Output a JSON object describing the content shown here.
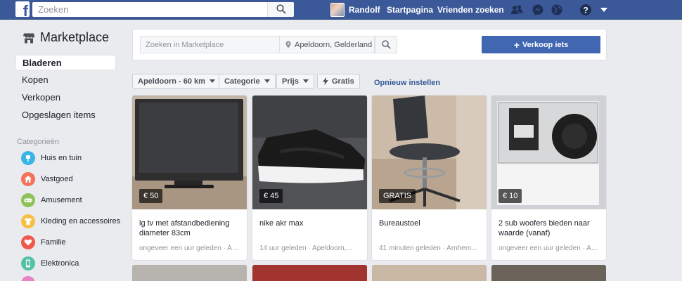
{
  "topbar": {
    "search_placeholder": "Zoeken",
    "user_name": "Randolf",
    "nav_home": "Startpagina",
    "nav_find_friends": "Vrienden zoeken"
  },
  "sidebar": {
    "title": "Marketplace",
    "items": [
      {
        "label": "Bladeren"
      },
      {
        "label": "Kopen"
      },
      {
        "label": "Verkopen"
      },
      {
        "label": "Opgeslagen items"
      }
    ],
    "categories_heading": "Categorieën",
    "categories": [
      {
        "label": "Huis en tuin",
        "color": "#3ab5e6",
        "icon": "home-icon"
      },
      {
        "label": "Vastgoed",
        "color": "#f3725a",
        "icon": "house-icon"
      },
      {
        "label": "Amusement",
        "color": "#8fc35a",
        "icon": "gamepad-icon"
      },
      {
        "label": "Kleding en accessoires",
        "color": "#f7c045",
        "icon": "shirt-icon"
      },
      {
        "label": "Familie",
        "color": "#f0584c",
        "icon": "heart-icon"
      },
      {
        "label": "Elektronica",
        "color": "#55c2a8",
        "icon": "phone-icon"
      }
    ]
  },
  "search_panel": {
    "search_placeholder": "Zoeken in Marketplace",
    "location": "Apeldoorn, Gelderland",
    "sell_label": "Verkoop iets"
  },
  "filters": {
    "location": "Apeldoorn - 60 km",
    "category": "Categorie",
    "price": "Prijs",
    "free": "Gratis",
    "reset": "Opnieuw instellen"
  },
  "listings": [
    {
      "price": "€ 50",
      "title": "lg tv met afstandbediening diameter 83cm",
      "meta": "ongeveer een uur geleden · Apeldoorn"
    },
    {
      "price": "€ 45",
      "title": "nike akr max",
      "meta": "14 uur geleden · Apeldoorn,..."
    },
    {
      "price": "GRATIS",
      "title": "Bureaustoel",
      "meta": "41 minuten geleden · Arnhem..."
    },
    {
      "price": "€ 10",
      "title": "2 sub woofers bieden naar waarde (vanaf)",
      "meta": "ongeveer een uur geleden · Apeldoorn"
    }
  ],
  "colors": {
    "brand": "#3b5998",
    "button": "#4267b2",
    "link": "#365899"
  }
}
